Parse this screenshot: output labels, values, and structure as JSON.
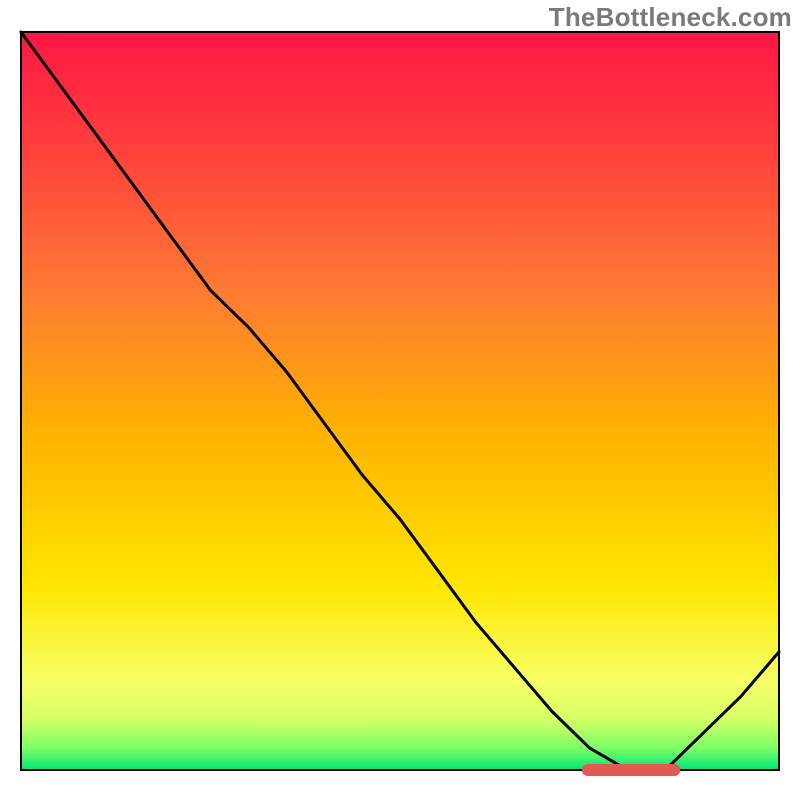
{
  "watermark": "TheBottleneck.com",
  "colors": {
    "curve": "#000000",
    "marker": "#e05a52",
    "gradient_stops": [
      {
        "offset": 0.0,
        "color": "#ff1744"
      },
      {
        "offset": 0.15,
        "color": "#ff3d3d"
      },
      {
        "offset": 0.35,
        "color": "#ff7a33"
      },
      {
        "offset": 0.55,
        "color": "#ffb400"
      },
      {
        "offset": 0.75,
        "color": "#ffe600"
      },
      {
        "offset": 0.88,
        "color": "#f6ff66"
      },
      {
        "offset": 0.93,
        "color": "#d8ff66"
      },
      {
        "offset": 0.97,
        "color": "#7dff66"
      },
      {
        "offset": 1.0,
        "color": "#00e676"
      }
    ]
  },
  "chart_data": {
    "type": "line",
    "title": "",
    "xlabel": "",
    "ylabel": "",
    "xlim": [
      0,
      100
    ],
    "ylim": [
      0,
      100
    ],
    "grid": false,
    "legend": false,
    "x": [
      0,
      5,
      10,
      15,
      20,
      25,
      30,
      35,
      40,
      45,
      50,
      55,
      60,
      65,
      70,
      75,
      80,
      82,
      85,
      90,
      95,
      100
    ],
    "values": [
      100,
      93,
      86,
      79,
      72,
      65,
      60,
      54,
      47,
      40,
      34,
      27,
      20,
      14,
      8,
      3,
      0,
      0,
      0,
      5,
      10,
      16
    ],
    "series": [
      {
        "name": "bottleneck-curve",
        "x_key": "x",
        "y_key": "values"
      }
    ],
    "marker_segment": {
      "x_start": 74,
      "x_end": 87,
      "y": 0
    }
  }
}
